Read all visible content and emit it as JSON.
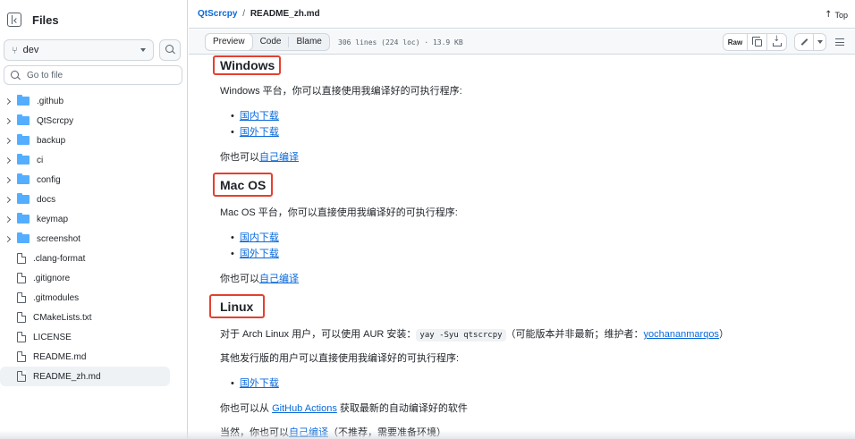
{
  "sidebar": {
    "title": "Files",
    "branch": "dev",
    "goto_placeholder": "Go to file",
    "items": [
      {
        "name": ".github",
        "type": "folder"
      },
      {
        "name": "QtScrcpy",
        "type": "folder"
      },
      {
        "name": "backup",
        "type": "folder"
      },
      {
        "name": "ci",
        "type": "folder"
      },
      {
        "name": "config",
        "type": "folder"
      },
      {
        "name": "docs",
        "type": "folder"
      },
      {
        "name": "keymap",
        "type": "folder"
      },
      {
        "name": "screenshot",
        "type": "folder"
      },
      {
        "name": ".clang-format",
        "type": "file"
      },
      {
        "name": ".gitignore",
        "type": "file"
      },
      {
        "name": ".gitmodules",
        "type": "file"
      },
      {
        "name": "CMakeLists.txt",
        "type": "file"
      },
      {
        "name": "LICENSE",
        "type": "file"
      },
      {
        "name": "README.md",
        "type": "file"
      },
      {
        "name": "README_zh.md",
        "type": "file",
        "selected": true
      }
    ]
  },
  "header": {
    "repo": "QtScrcpy",
    "separator": "/",
    "file": "README_zh.md",
    "top_label": "Top"
  },
  "filebar": {
    "tabs": [
      "Preview",
      "Code",
      "Blame"
    ],
    "active_tab": "Preview",
    "info": "306 lines (224 loc) · 13.9 KB",
    "raw_label": "Raw"
  },
  "content": {
    "windows": {
      "heading": "Windows",
      "desc": "Windows 平台，你可以直接使用我编译好的可执行程序:",
      "links": [
        "国内下载",
        "国外下载"
      ],
      "self_prefix": "你也可以",
      "self_link": "自己编译"
    },
    "macos": {
      "heading": "Mac OS",
      "desc": "Mac OS 平台，你可以直接使用我编译好的可执行程序:",
      "links": [
        "国内下载",
        "国外下载"
      ],
      "self_prefix": "你也可以",
      "self_link": "自己编译"
    },
    "linux": {
      "heading": "Linux",
      "arch_prefix": "对于 Arch Linux 用户，可以使用 AUR 安装：",
      "arch_code": "yay -Syu qtscrcpy",
      "arch_mid": "（可能版本并非最新；维护者：",
      "arch_link": "yochananmarqos",
      "arch_suffix": "）",
      "other": "其他发行版的用户可以直接使用我编译好的可执行程序:",
      "links": [
        "国外下载"
      ],
      "ga_prefix": "你也可以从 ",
      "ga_link": "GitHub Actions",
      "ga_suffix": " 获取最新的自动编译好的软件",
      "last_prefix": "当然，你也可以",
      "last_link": "自己编译",
      "last_suffix": "（不推荐，需要准备环境）"
    }
  },
  "colors": {
    "link": "#0969da",
    "highlight_box": "#e5402f",
    "folder": "#54aeff"
  }
}
